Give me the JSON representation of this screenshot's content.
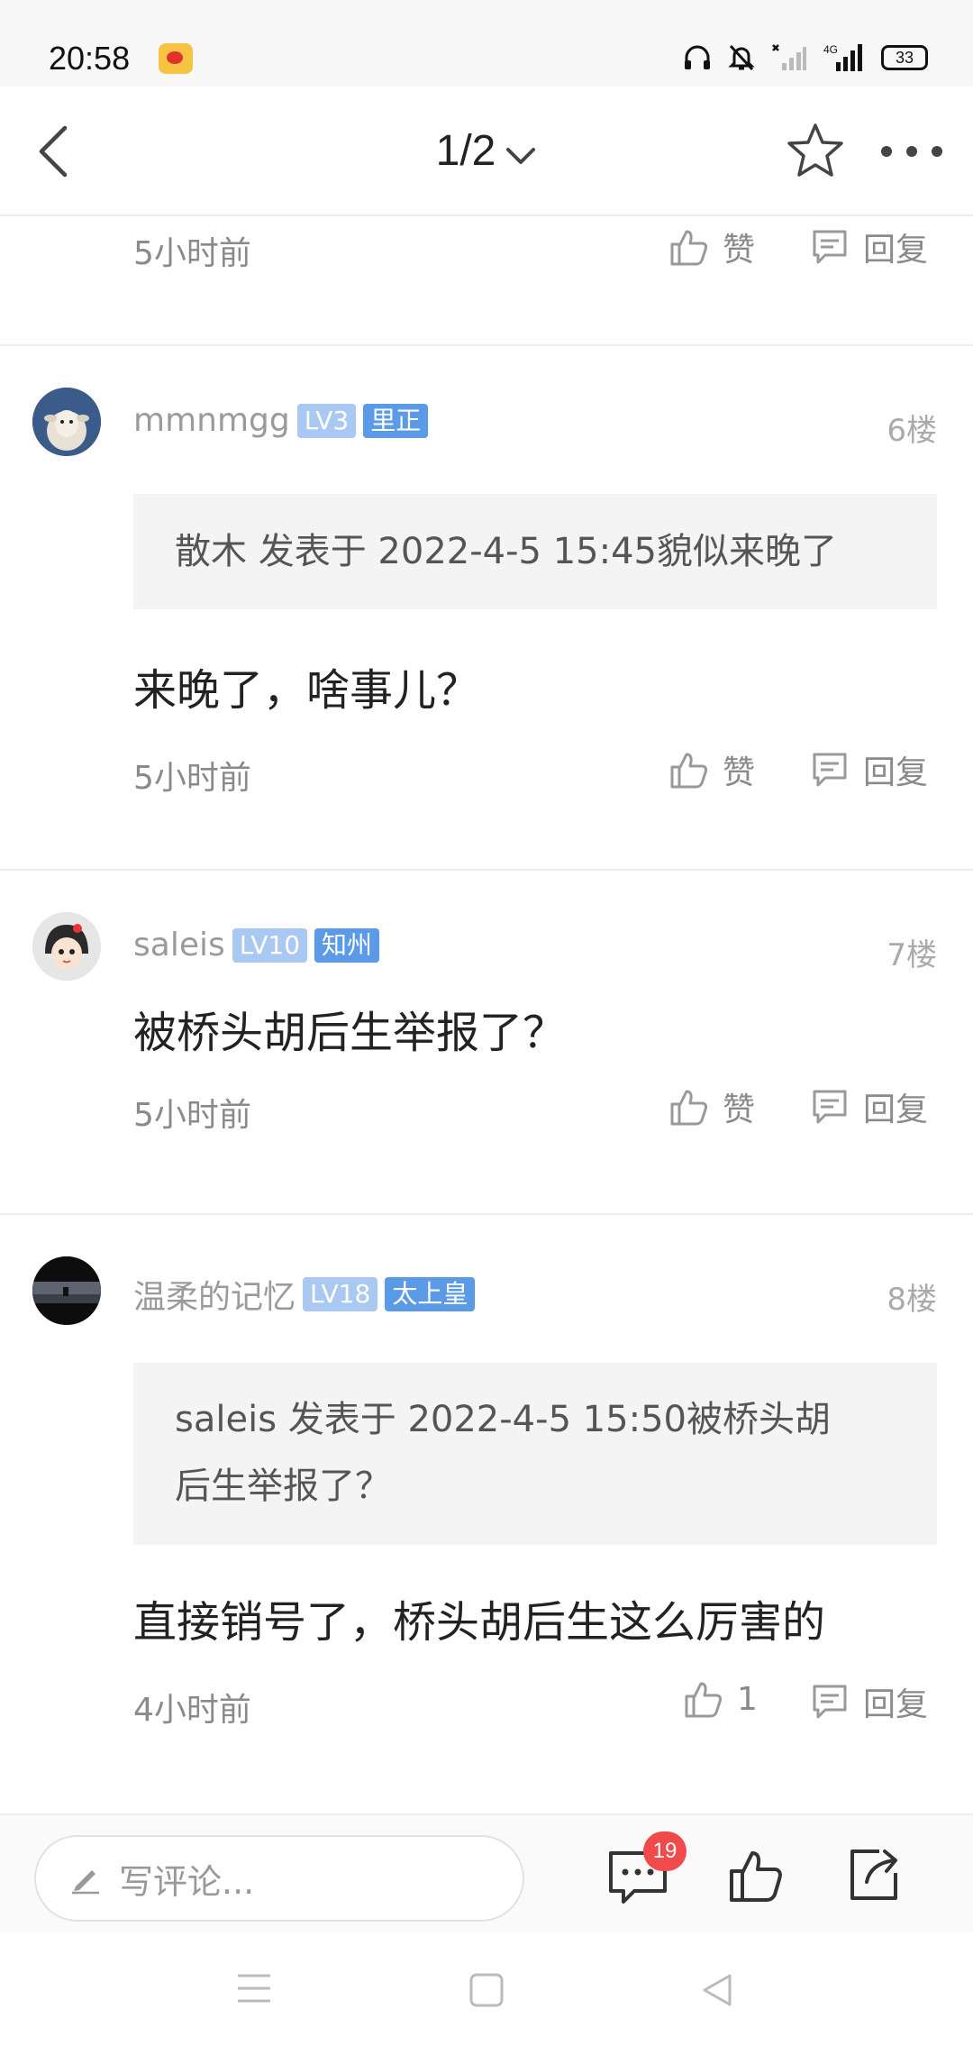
{
  "status_bar": {
    "time": "20:58",
    "battery": "33"
  },
  "nav": {
    "page_indicator": "1/2"
  },
  "top_partial": {
    "time": "5小时前",
    "like_label": "赞",
    "reply_label": "回复"
  },
  "posts": [
    {
      "username": "mmnmgg",
      "level": "LV3",
      "title": "里正",
      "floor": "6楼",
      "quote": "散木 发表于 2022-4-5 15:45貌似来晚了",
      "body": "来晚了，啥事儿？",
      "time": "5小时前",
      "like_label": "赞",
      "reply_label": "回复"
    },
    {
      "username": "saleis",
      "level": "LV10",
      "title": "知州",
      "floor": "7楼",
      "body": "被桥头胡后生举报了？",
      "time": "5小时前",
      "like_label": "赞",
      "reply_label": "回复"
    },
    {
      "username": "温柔的记忆",
      "level": "LV18",
      "title": "太上皇",
      "floor": "8楼",
      "quote_line1": "saleis 发表于 2022-4-5 15:50被桥头胡",
      "quote_line2": "后生举报了？",
      "body": "直接销号了，桥头胡后生这么厉害的",
      "time": "4小时前",
      "like_label": "1",
      "reply_label": "回复"
    }
  ],
  "comment_bar": {
    "placeholder": "写评论...",
    "comment_count": "19"
  }
}
